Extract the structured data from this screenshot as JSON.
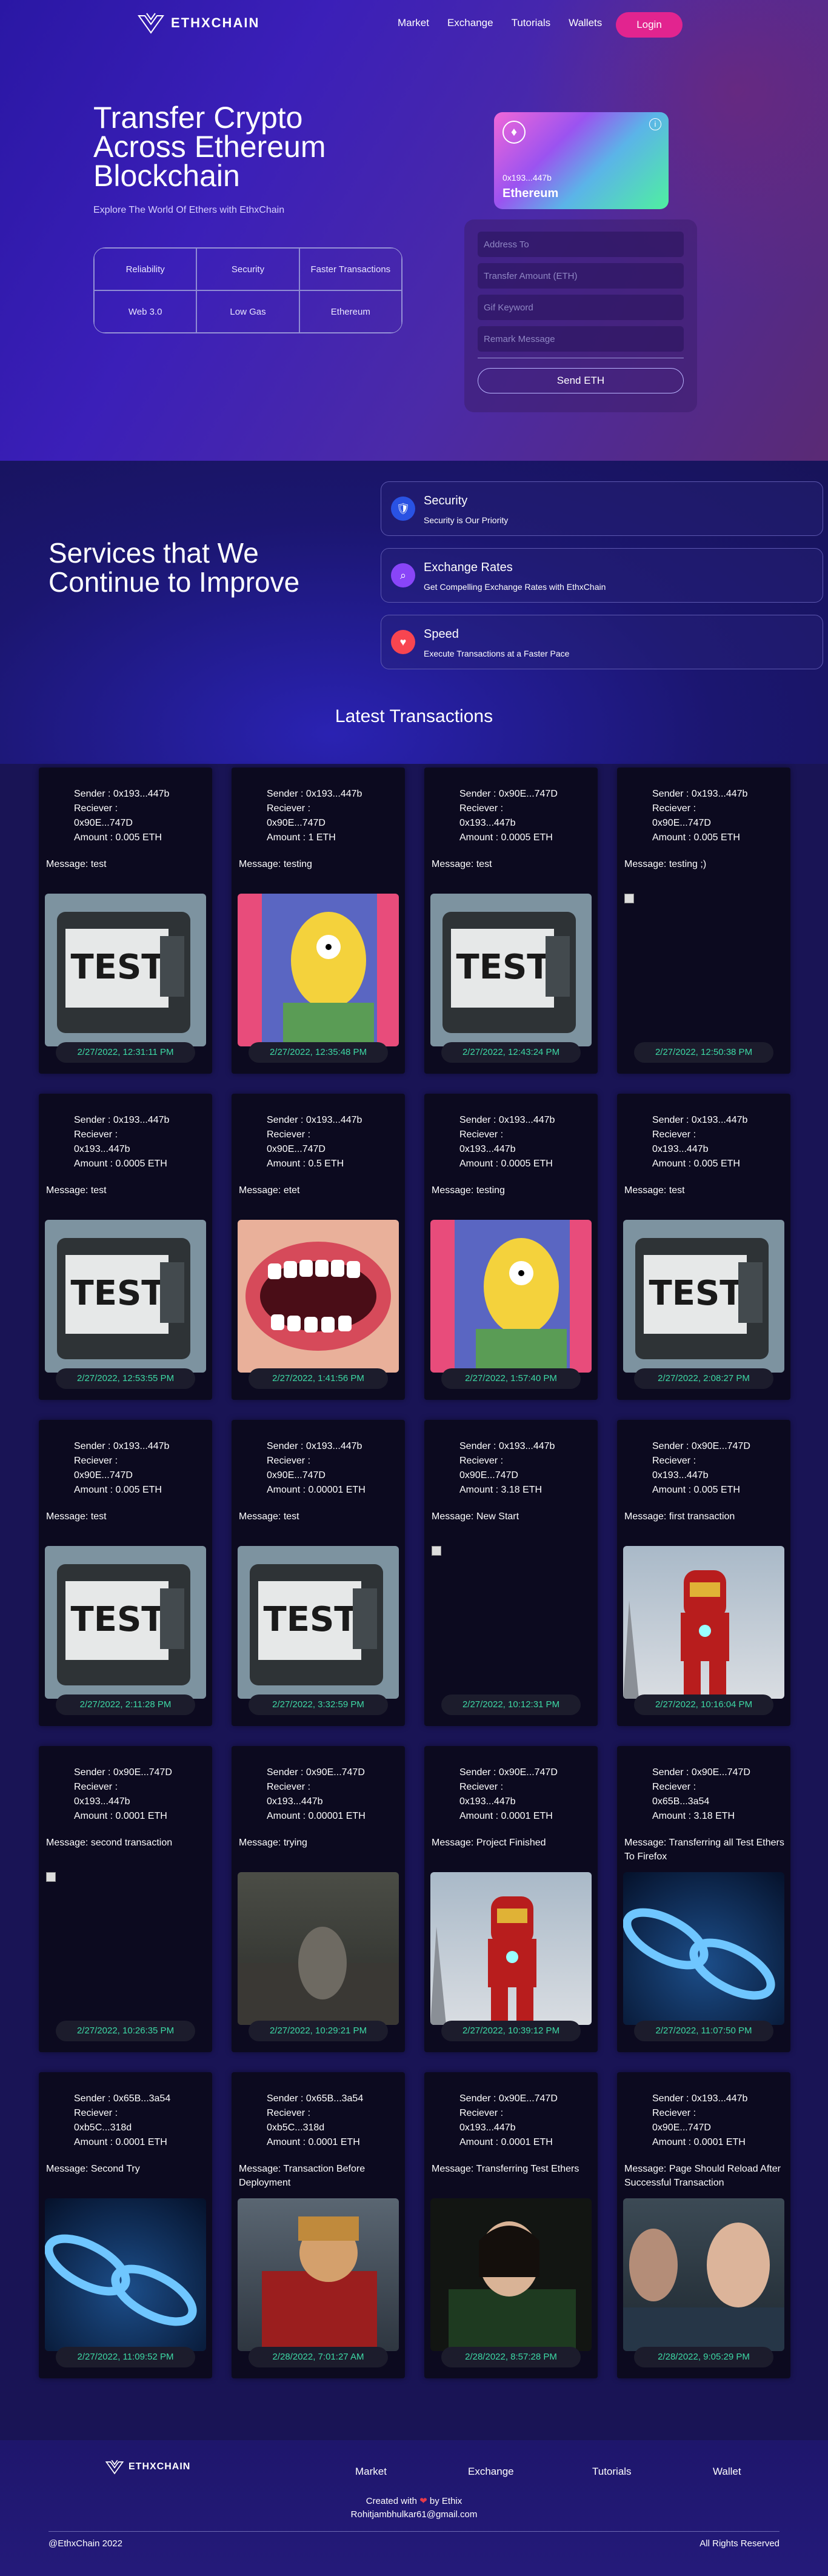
{
  "nav": {
    "logo": "ETHXCHAIN",
    "links": [
      "Market",
      "Exchange",
      "Tutorials",
      "Wallets"
    ],
    "login": "Login"
  },
  "hero": {
    "title": "Transfer Crypto Across Ethereum Blockchain",
    "subtitle": "Explore The World Of Ethers with EthxChain",
    "features": [
      "Reliability",
      "Security",
      "Faster Transactions",
      "Web 3.0",
      "Low Gas",
      "Ethereum"
    ],
    "card": {
      "address": "0x193...447b",
      "name": "Ethereum"
    },
    "form": {
      "placeholders": [
        "Address To",
        "Transfer Amount (ETH)",
        "Gif Keyword",
        "Remark Message"
      ],
      "send": "Send ETH"
    }
  },
  "services": {
    "title": "Services that We Continue to Improve",
    "items": [
      {
        "title": "Security",
        "desc": "Security is Our Priority",
        "icon": "shield-icon",
        "color": "#2952e3"
      },
      {
        "title": "Exchange Rates",
        "desc": "Get Compelling Exchange Rates with EthxChain",
        "icon": "search-icon",
        "color": "#8945f8"
      },
      {
        "title": "Speed",
        "desc": "Execute Transactions at a Faster Pace",
        "icon": "heart-icon",
        "color": "#f84550"
      }
    ]
  },
  "transactions": {
    "title": "Latest Transactions",
    "items": [
      {
        "sender": "Sender : 0x193...447b",
        "receiver_label": "Reciever :",
        "receiver": "0x90E...747D",
        "amount": "Amount : 0.005 ETH",
        "message": "Message: test",
        "time": "2/27/2022, 12:31:11 PM",
        "img": "test"
      },
      {
        "sender": "Sender : 0x193...447b",
        "receiver_label": "Reciever :",
        "receiver": "0x90E...747D",
        "amount": "Amount : 1 ETH",
        "message": "Message: testing",
        "time": "2/27/2022, 12:35:48 PM",
        "img": "simpsons"
      },
      {
        "sender": "Sender : 0x90E...747D",
        "receiver_label": "Reciever :",
        "receiver": "0x193...447b",
        "amount": "Amount : 0.0005 ETH",
        "message": "Message: test",
        "time": "2/27/2022, 12:43:24 PM",
        "img": "test"
      },
      {
        "sender": "Sender : 0x193...447b",
        "receiver_label": "Reciever :",
        "receiver": "0x90E...747D",
        "amount": "Amount : 0.005 ETH",
        "message": "Message: testing ;)",
        "time": "2/27/2022, 12:50:38 PM",
        "img": "broken"
      },
      {
        "sender": "Sender : 0x193...447b",
        "receiver_label": "Reciever :",
        "receiver": "0x193...447b",
        "amount": "Amount : 0.0005 ETH",
        "message": "Message: test",
        "time": "2/27/2022, 12:53:55 PM",
        "img": "test"
      },
      {
        "sender": "Sender : 0x193...447b",
        "receiver_label": "Reciever :",
        "receiver": "0x90E...747D",
        "amount": "Amount : 0.5 ETH",
        "message": "Message: etet",
        "time": "2/27/2022, 1:41:56 PM",
        "img": "teeth"
      },
      {
        "sender": "Sender : 0x193...447b",
        "receiver_label": "Reciever :",
        "receiver": "0x193...447b",
        "amount": "Amount : 0.0005 ETH",
        "message": "Message: testing",
        "time": "2/27/2022, 1:57:40 PM",
        "img": "simpsons"
      },
      {
        "sender": "Sender : 0x193...447b",
        "receiver_label": "Reciever :",
        "receiver": "0x193...447b",
        "amount": "Amount : 0.005 ETH",
        "message": "Message: test",
        "time": "2/27/2022, 2:08:27 PM",
        "img": "test"
      },
      {
        "sender": "Sender : 0x193...447b",
        "receiver_label": "Reciever :",
        "receiver": "0x90E...747D",
        "amount": "Amount : 0.005 ETH",
        "message": "Message: test",
        "time": "2/27/2022, 2:11:28 PM",
        "img": "test"
      },
      {
        "sender": "Sender : 0x193...447b",
        "receiver_label": "Reciever :",
        "receiver": "0x90E...747D",
        "amount": "Amount : 0.00001 ETH",
        "message": "Message: test",
        "time": "2/27/2022, 3:32:59 PM",
        "img": "test"
      },
      {
        "sender": "Sender : 0x193...447b",
        "receiver_label": "Reciever :",
        "receiver": "0x90E...747D",
        "amount": "Amount : 3.18 ETH",
        "message": "Message: New Start",
        "time": "2/27/2022, 10:12:31 PM",
        "img": "broken"
      },
      {
        "sender": "Sender : 0x90E...747D",
        "receiver_label": "Reciever :",
        "receiver": "0x193...447b",
        "amount": "Amount : 0.005 ETH",
        "message": "Message: first transaction",
        "time": "2/27/2022, 10:16:04 PM",
        "img": "ironman"
      },
      {
        "sender": "Sender : 0x90E...747D",
        "receiver_label": "Reciever :",
        "receiver": "0x193...447b",
        "amount": "Amount : 0.0001 ETH",
        "message": "Message: second transaction",
        "time": "2/27/2022, 10:26:35 PM",
        "img": "broken"
      },
      {
        "sender": "Sender : 0x90E...747D",
        "receiver_label": "Reciever :",
        "receiver": "0x193...447b",
        "amount": "Amount : 0.00001 ETH",
        "message": "Message: trying",
        "time": "2/27/2022, 10:29:21 PM",
        "img": "dark"
      },
      {
        "sender": "Sender : 0x90E...747D",
        "receiver_label": "Reciever :",
        "receiver": "0x193...447b",
        "amount": "Amount : 0.0001 ETH",
        "message": "Message: Project Finished",
        "time": "2/27/2022, 10:39:12 PM",
        "img": "ironman"
      },
      {
        "sender": "Sender : 0x90E...747D",
        "receiver_label": "Reciever :",
        "receiver": "0x65B...3a54",
        "amount": "Amount : 3.18 ETH",
        "message": "Message: Transferring all Test Ethers To Firefox",
        "time": "2/27/2022, 11:07:50 PM",
        "img": "chain"
      },
      {
        "sender": "Sender : 0x65B...3a54",
        "receiver_label": "Reciever :",
        "receiver": "0xb5C...318d",
        "amount": "Amount : 0.0001 ETH",
        "message": "Message: Second Try",
        "time": "2/27/2022, 11:09:52 PM",
        "img": "chain"
      },
      {
        "sender": "Sender : 0x65B...3a54",
        "receiver_label": "Reciever :",
        "receiver": "0xb5C...318d",
        "amount": "Amount : 0.0001 ETH",
        "message": "Message: Transaction Before Deployment",
        "time": "2/28/2022, 7:01:27 AM",
        "img": "thor"
      },
      {
        "sender": "Sender : 0x90E...747D",
        "receiver_label": "Reciever :",
        "receiver": "0x193...447b",
        "amount": "Amount : 0.0001 ETH",
        "message": "Message: Transferring Test Ethers",
        "time": "2/28/2022, 8:57:28 PM",
        "img": "loki"
      },
      {
        "sender": "Sender : 0x193...447b",
        "receiver_label": "Reciever :",
        "receiver": "0x90E...747D",
        "amount": "Amount : 0.0001 ETH",
        "message": "Message: Page Should Reload After Successful Transaction",
        "time": "2/28/2022, 9:05:29 PM",
        "img": "cap"
      }
    ]
  },
  "footer": {
    "logo": "ETHXCHAIN",
    "links": [
      "Market",
      "Exchange",
      "Tutorials",
      "Wallet"
    ],
    "credit_prefix": "Created with",
    "credit_suffix": "by Ethix",
    "email": "Rohitjambhulkar61@gmail.com",
    "copyright": "@EthxChain 2022",
    "rights": "All Rights Reserved"
  }
}
